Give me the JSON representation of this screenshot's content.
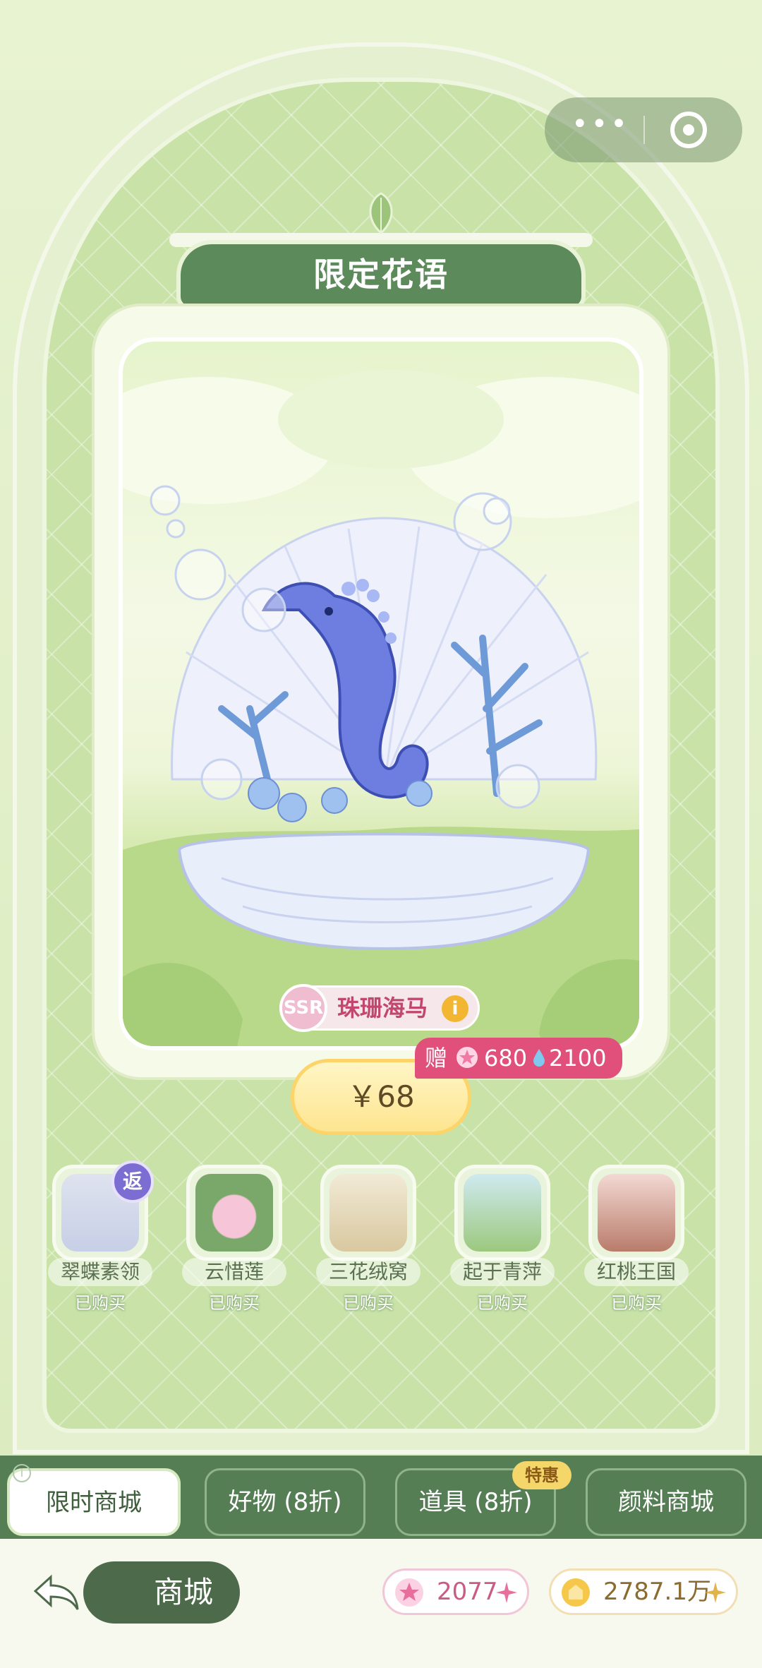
{
  "topbar": {
    "more_icon": "more-dots-icon",
    "close_icon": "target-close-icon"
  },
  "banner": {
    "title": "限定花语"
  },
  "featured": {
    "rarity": "SSR",
    "name": "珠珊海马",
    "price": "￥68",
    "gift": {
      "label": "赠",
      "gems": "680",
      "water": "2100"
    }
  },
  "items": [
    {
      "name": "翠蝶素领",
      "status": "已购买",
      "badge": "返"
    },
    {
      "name": "云惜莲",
      "status": "已购买"
    },
    {
      "name": "三花绒窝",
      "status": "已购买"
    },
    {
      "name": "起于青萍",
      "status": "已购买"
    },
    {
      "name": "红桃王国",
      "status": "已购买"
    }
  ],
  "tabs": [
    {
      "label": "限时商城",
      "active": true
    },
    {
      "label": "好物 (8折)"
    },
    {
      "label": "道具 (8折)",
      "badge": "特惠"
    },
    {
      "label": "颜料商城"
    }
  ],
  "footer": {
    "back_label": "商城",
    "gems": "2077",
    "coins": "2787.1万"
  },
  "colors": {
    "primary": "#567e55",
    "accent_pink": "#e0507a",
    "price_gold": "#fde58f"
  }
}
